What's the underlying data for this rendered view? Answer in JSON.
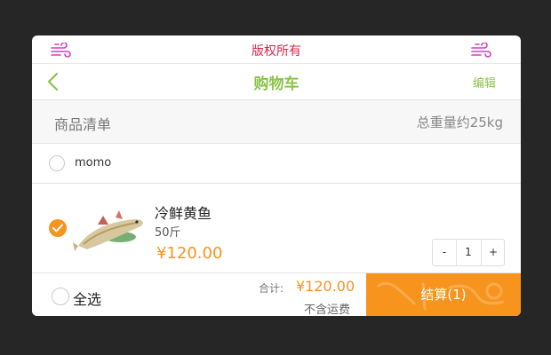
{
  "topbar": {
    "title": "版权所有",
    "wind_icon": "wind-icon",
    "color": "#e0224a"
  },
  "nav": {
    "back_icon": "chevron-left-icon",
    "title": "购物车",
    "edit": "编辑",
    "accent": "#8bc34a"
  },
  "list_header": {
    "left": "商品清单",
    "right": "总重量约25kg"
  },
  "store": {
    "name": "momo",
    "checked": false
  },
  "item": {
    "checked": true,
    "image": "fish-image",
    "name": "冷鲜黄鱼",
    "weight": "50斤",
    "price": "¥120.00",
    "quantity": "1",
    "minus": "-",
    "plus": "+"
  },
  "footer": {
    "select_all": "全选",
    "total_label": "合计:",
    "total_value": "¥120.00",
    "shipping_note": "不含运费",
    "checkout": "结算(1)",
    "accent": "#f7941d"
  }
}
